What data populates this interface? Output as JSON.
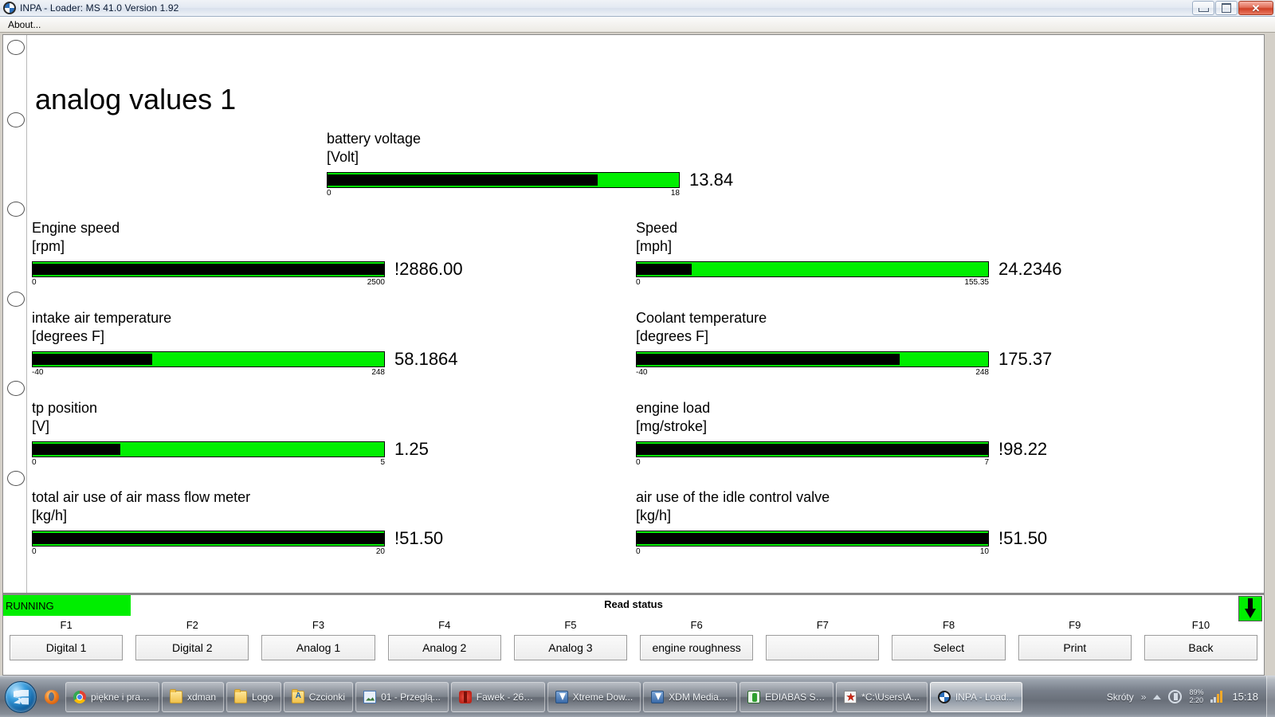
{
  "window": {
    "title": "INPA - Loader:  MS 41.0 Version 1.92",
    "icon": "bmw-roundel-icon",
    "minimize_label": "Minimize",
    "maximize_label": "Maximize",
    "close_label": "Close"
  },
  "menu": {
    "items": [
      {
        "label": "About..."
      }
    ]
  },
  "page": {
    "title": "analog values 1"
  },
  "chart_data": {
    "type": "bar",
    "title": "analog values 1",
    "orientation": "horizontal",
    "note": "Each gauge is a horizontal bar: black fill over green track, scale min/max printed beneath. A leading '!' on the value means the reading is outside the displayed scale.",
    "gauges": [
      {
        "name": "battery voltage",
        "unit": "[Volt]",
        "value": 13.84,
        "value_text": "13.84",
        "min": 0,
        "max": 18,
        "min_label": "0",
        "max_label": "18",
        "fill_pct": 76.9,
        "out_of_range": false
      },
      {
        "name": "Engine speed",
        "unit": "[rpm]",
        "value": 2886.0,
        "value_text": "!2886.00",
        "min": 0,
        "max": 2500,
        "min_label": "0",
        "max_label": "2500",
        "fill_pct": 100,
        "out_of_range": true
      },
      {
        "name": "Speed",
        "unit": "[mph]",
        "value": 24.2346,
        "value_text": "24.2346",
        "min": 0,
        "max": 155.35,
        "min_label": "0",
        "max_label": "155.35",
        "fill_pct": 15.6,
        "out_of_range": false
      },
      {
        "name": "intake air temperature",
        "unit": "[degrees F]",
        "value": 58.1864,
        "value_text": "58.1864",
        "min": -40,
        "max": 248,
        "min_label": "-40",
        "max_label": "248",
        "fill_pct": 34.1,
        "out_of_range": false
      },
      {
        "name": "Coolant temperature",
        "unit": "[degrees F]",
        "value": 175.37,
        "value_text": "175.37",
        "min": -40,
        "max": 248,
        "min_label": "-40",
        "max_label": "248",
        "fill_pct": 74.8,
        "out_of_range": false
      },
      {
        "name": "tp position",
        "unit": "[V]",
        "value": 1.25,
        "value_text": "1.25",
        "min": 0,
        "max": 5,
        "min_label": "0",
        "max_label": "5",
        "fill_pct": 25,
        "out_of_range": false
      },
      {
        "name": "engine load",
        "unit": "[mg/stroke]",
        "value": 98.22,
        "value_text": "!98.22",
        "min": 0,
        "max": 7,
        "min_label": "0",
        "max_label": "7",
        "fill_pct": 100,
        "out_of_range": true
      },
      {
        "name": "total air use of air mass flow meter",
        "unit": "[kg/h]",
        "value": 51.5,
        "value_text": "!51.50",
        "min": 0,
        "max": 20,
        "min_label": "0",
        "max_label": "20",
        "fill_pct": 100,
        "out_of_range": true
      },
      {
        "name": "air use of the idle control valve",
        "unit": "[kg/h]",
        "value": 51.5,
        "value_text": "!51.50",
        "min": 0,
        "max": 10,
        "min_label": "0",
        "max_label": "10",
        "fill_pct": 100,
        "out_of_range": true
      }
    ]
  },
  "status": {
    "running_label": "RUNNING",
    "read_status_label": "Read status",
    "scroll_icon": "arrow-down-icon"
  },
  "fkeys": [
    {
      "key": "F1",
      "label": "Digital 1"
    },
    {
      "key": "F2",
      "label": "Digital 2"
    },
    {
      "key": "F3",
      "label": "Analog 1"
    },
    {
      "key": "F4",
      "label": "Analog 2"
    },
    {
      "key": "F5",
      "label": "Analog 3"
    },
    {
      "key": "F6",
      "label": "engine roughness"
    },
    {
      "key": "F7",
      "label": ""
    },
    {
      "key": "F8",
      "label": "Select"
    },
    {
      "key": "F9",
      "label": "Print"
    },
    {
      "key": "F10",
      "label": "Back"
    }
  ],
  "taskbar": {
    "start_label": "Start",
    "quicklaunch": [
      {
        "icon": "firefox-icon",
        "label": "Firefox"
      }
    ],
    "tasks": [
      {
        "icon": "chrome-icon",
        "label": "piękne i prak...",
        "active": false,
        "kind": "chrome"
      },
      {
        "icon": "folder-icon",
        "label": "xdman",
        "active": false,
        "kind": "folder"
      },
      {
        "icon": "folder-icon",
        "label": "Logo",
        "active": false,
        "kind": "folder"
      },
      {
        "icon": "fonts-folder-icon",
        "label": "Czcionki",
        "active": false,
        "kind": "folderA"
      },
      {
        "icon": "image-viewer-icon",
        "label": "01 - Przeglą...",
        "active": false,
        "kind": "img"
      },
      {
        "icon": "bug-icon",
        "label": "Fawek - 267...",
        "active": false,
        "kind": "bug"
      },
      {
        "icon": "download-icon",
        "label": "Xtreme Dow...",
        "active": false,
        "kind": "dl"
      },
      {
        "icon": "download-icon",
        "label": "XDM Media ...",
        "active": false,
        "kind": "dl"
      },
      {
        "icon": "ediabas-icon",
        "label": "EDIABAS Ser...",
        "active": false,
        "kind": "ediabas"
      },
      {
        "icon": "terminal-icon",
        "label": "*C:\\Users\\A...",
        "active": false,
        "kind": "term"
      },
      {
        "icon": "inpa-icon",
        "label": "INPA - Load...",
        "active": true,
        "kind": "inpa"
      }
    ],
    "tray": {
      "toolbar_label": "Skróty",
      "overflow_icon": "chevron-right-icon",
      "show_hidden_icon": "triangle-up-icon",
      "action_center_icon": "action-center-icon",
      "battery_percent": "89%",
      "battery_time": "2:20",
      "network_icon": "network-signal-icon",
      "clock": "15:18"
    }
  }
}
